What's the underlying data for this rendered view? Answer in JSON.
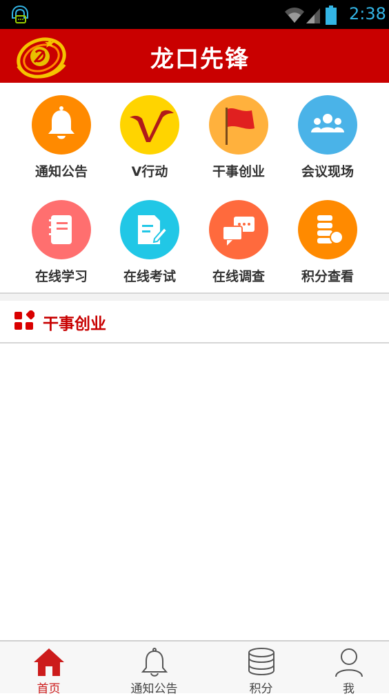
{
  "status_bar": {
    "time": "2:38"
  },
  "header": {
    "title": "龙口先锋"
  },
  "menu": [
    {
      "label": "通知公告",
      "icon": "bell-icon",
      "color": "#ff8a00"
    },
    {
      "label": "V行动",
      "icon": "v-action-icon",
      "color": "#ffd400"
    },
    {
      "label": "干事创业",
      "icon": "flag-icon",
      "color": "#ffb13d"
    },
    {
      "label": "会议现场",
      "icon": "people-icon",
      "color": "#4ab3e8"
    },
    {
      "label": "在线学习",
      "icon": "notebook-icon",
      "color": "#ff6f6f"
    },
    {
      "label": "在线考试",
      "icon": "exam-icon",
      "color": "#21c7e6"
    },
    {
      "label": "在线调查",
      "icon": "chat-icon",
      "color": "#ff6a3d"
    },
    {
      "label": "积分查看",
      "icon": "points-icon",
      "color": "#ff8a00"
    }
  ],
  "section": {
    "title": "干事创业"
  },
  "tabs": [
    {
      "label": "首页",
      "icon": "home-icon",
      "active": true
    },
    {
      "label": "通知公告",
      "icon": "bell-outline-icon",
      "active": false
    },
    {
      "label": "积分",
      "icon": "coins-icon",
      "active": false
    },
    {
      "label": "我",
      "icon": "person-icon",
      "active": false
    }
  ],
  "colors": {
    "brand_red": "#c90000",
    "tab_active": "#cc1b1b"
  }
}
